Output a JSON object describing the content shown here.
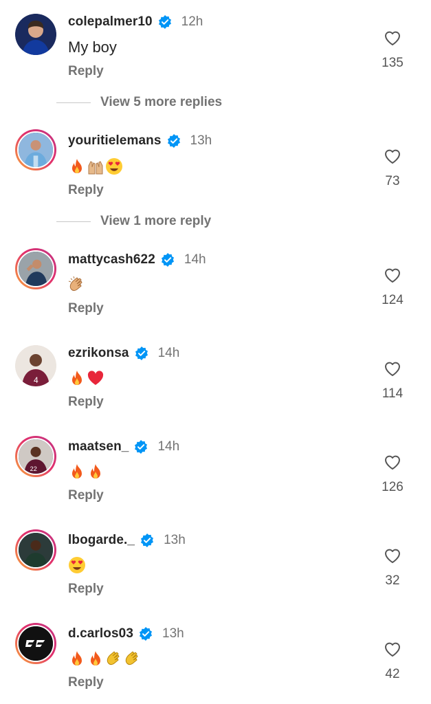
{
  "comments": [
    {
      "username": "colepalmer10",
      "time": "12h",
      "text": "My boy",
      "emoji": [],
      "reply_label": "Reply",
      "likes": "135",
      "avatar_icon": "player-photo-avatar"
    },
    {
      "username": "youritielemans",
      "time": "13h",
      "text": "",
      "emoji": [
        "fire",
        "raised-hands",
        "heart-eyes"
      ],
      "reply_label": "Reply",
      "likes": "73",
      "avatar_icon": "player-photo-avatar"
    },
    {
      "username": "mattycash622",
      "time": "14h",
      "text": "",
      "emoji": [
        "clapping-hands"
      ],
      "reply_label": "Reply",
      "likes": "124",
      "avatar_icon": "player-photo-avatar"
    },
    {
      "username": "ezrikonsa",
      "time": "14h",
      "text": "",
      "emoji": [
        "fire",
        "red-heart"
      ],
      "reply_label": "Reply",
      "likes": "114",
      "avatar_icon": "player-photo-avatar"
    },
    {
      "username": "maatsen_",
      "time": "14h",
      "text": "",
      "emoji": [
        "fire",
        "fire"
      ],
      "reply_label": "Reply",
      "likes": "126",
      "avatar_icon": "player-photo-avatar"
    },
    {
      "username": "lbogarde._",
      "time": "13h",
      "text": "",
      "emoji": [
        "heart-eyes"
      ],
      "reply_label": "Reply",
      "likes": "32",
      "avatar_icon": "player-photo-avatar"
    },
    {
      "username": "d.carlos03",
      "time": "13h",
      "text": "",
      "emoji": [
        "fire",
        "fire",
        "clapping-hands",
        "clapping-hands"
      ],
      "reply_label": "Reply",
      "likes": "42",
      "avatar_icon": "dc-logo-avatar"
    }
  ],
  "view_more": [
    {
      "label": "View 5 more replies"
    },
    {
      "label": "View 1 more reply"
    }
  ],
  "colors": {
    "verified": "#0095f6",
    "muted": "#737373",
    "story_ring_start": "#f9a93a",
    "story_ring_end": "#c13584"
  }
}
